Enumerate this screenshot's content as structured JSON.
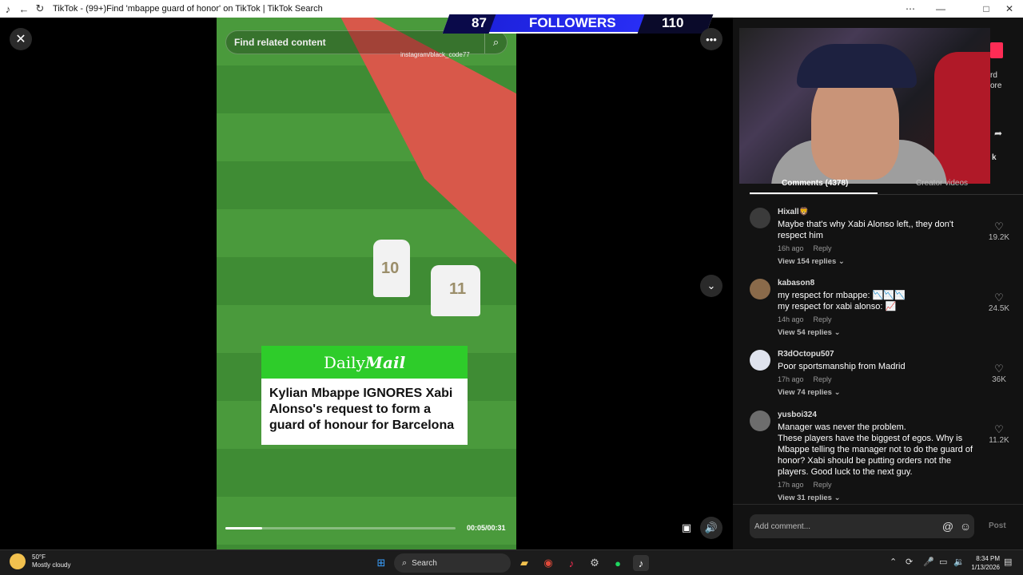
{
  "window": {
    "title": "TikTok - (99+)Find 'mbappe guard of honor' on TikTok | TikTok Search",
    "back_icon": "←",
    "refresh_icon": "↻",
    "minimize": "—",
    "maximize": "□",
    "close": "✕",
    "more": "⋯"
  },
  "player": {
    "search_placeholder": "Find related content",
    "instagram_tag": "instagram/black_code77",
    "followers": {
      "left": "87",
      "label": "FOLLOWERS",
      "right": "110"
    },
    "daily_mail_brand_light": "Daily",
    "daily_mail_brand_bold": "Mail",
    "headline": "Kylian Mbappe IGNORES Xabi Alonso's request to form a guard of honour for Barcelona",
    "time": "00:05/00:31",
    "progress": 0.16,
    "jersey_1": "10",
    "jersey_2": "11"
  },
  "side": {
    "peek_text_1": "rd",
    "peek_text_2": "ore",
    "peek_k": "k"
  },
  "tabs": {
    "comments": "Comments (4378)",
    "creator": "Creator videos"
  },
  "comments": [
    {
      "user": "Hixall🦁",
      "text": "Maybe that's why Xabi Alonso left,, they don't respect him",
      "time": "16h ago",
      "reply": "Reply",
      "replies": "View 154 replies",
      "likes": "19.2K"
    },
    {
      "user": "kabason8",
      "text": "my respect for mbappe: 📉📉📉\nmy respect for xabi alonso: 📈",
      "time": "14h ago",
      "reply": "Reply",
      "replies": "View 54 replies",
      "likes": "24.5K"
    },
    {
      "user": "R3dOctopu507",
      "text": "Poor sportsmanship from Madrid",
      "time": "17h ago",
      "reply": "Reply",
      "replies": "View 74 replies",
      "likes": "36K"
    },
    {
      "user": "yusboi324",
      "text": "Manager was never the problem.\nThese players have the biggest of egos. Why is Mbappe telling the manager not to do the guard of honor? Xabi should be putting orders not the players. Good luck to the next guy.",
      "time": "17h ago",
      "reply": "Reply",
      "replies": "View 31 replies",
      "likes": "11.2K"
    }
  ],
  "add_comment": {
    "placeholder": "Add comment...",
    "post": "Post",
    "mention_icon": "@",
    "emoji_icon": "☺"
  },
  "taskbar": {
    "temp": "50°F",
    "condition": "Mostly cloudy",
    "search": "Search",
    "time": "8:34 PM",
    "date": "1/13/2026"
  }
}
